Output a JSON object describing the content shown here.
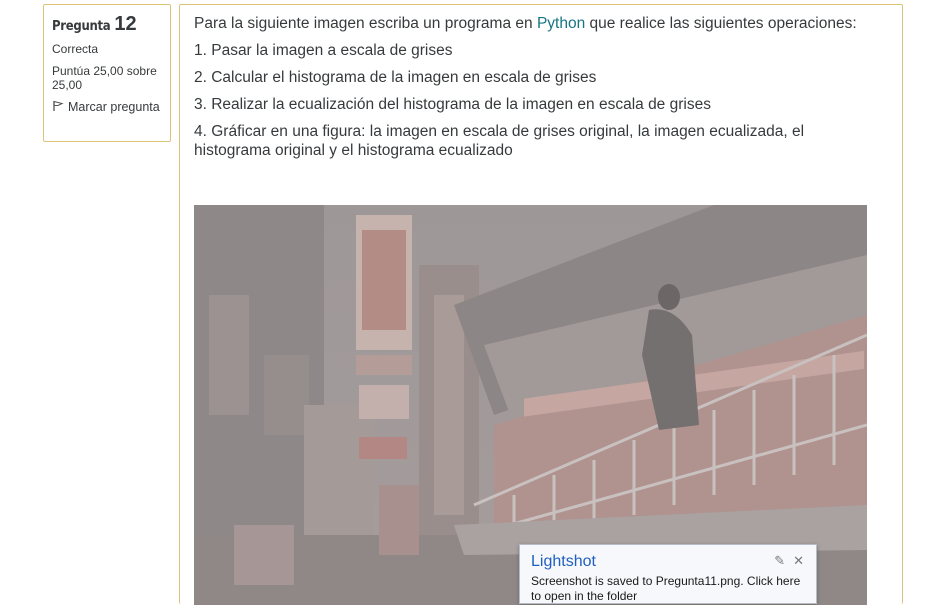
{
  "question_info": {
    "label": "Pregunta",
    "number": "12",
    "state": "Correcta",
    "grade": "Puntúa 25,00 sobre 25,00",
    "flag_label": "Marcar pregunta"
  },
  "question_text": {
    "intro_before": "Para la siguiente imagen escriba un programa en ",
    "intro_link": "Python",
    "intro_after": " que realice las siguientes operaciones:",
    "steps": [
      "1. Pasar la imagen a escala de grises",
      "2. Calcular el histograma de la imagen en escala de grises",
      "3. Realizar la ecualización del histograma de la imagen en escala de grises",
      "4. Gráficar en una figura: la imagen en escala de grises original, la imagen ecualizada, el histograma original y el histograma ecualizado"
    ]
  },
  "notification": {
    "title": "Lightshot",
    "message": "Screenshot is saved to Pregunta11.png. Click here to open in the folder",
    "pin_icon": "pin-icon",
    "close_icon": "close-icon"
  },
  "colors": {
    "border_accent": "#dcc37a",
    "link": "#177582",
    "toast_title": "#1f5fbf"
  }
}
